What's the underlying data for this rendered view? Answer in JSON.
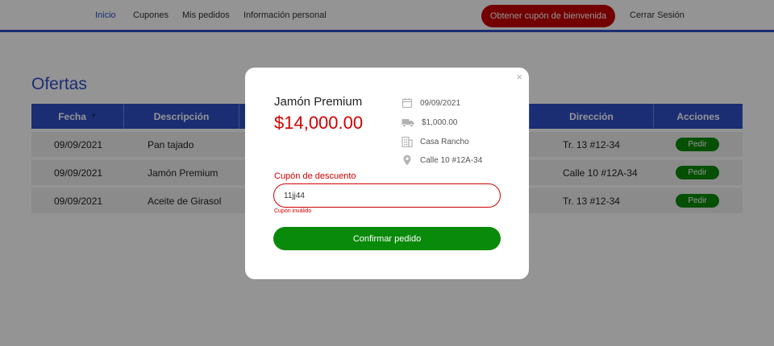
{
  "nav": {
    "items": [
      {
        "label": "Inicio"
      },
      {
        "label": "Cupones"
      },
      {
        "label": "Mis pedidos"
      },
      {
        "label": "Información personal"
      }
    ],
    "coupon_button": "Obtener cupón de bienvenida",
    "logout": "Cerrar Sesión",
    "active_item": "Inicio"
  },
  "page": {
    "title": "Ofertas",
    "table": {
      "headers": {
        "fecha": "Fecha",
        "descripcion": "Descripción",
        "direccion": "Dirección",
        "acciones": "Acciones"
      },
      "rows": [
        {
          "fecha": "09/09/2021",
          "descripcion": "Pan tajado",
          "direccion": "Tr. 13 #12-34",
          "action": "Pedir"
        },
        {
          "fecha": "09/09/2021",
          "descripcion": "Jamón Premium",
          "direccion": "Calle 10 #12A-34",
          "action": "Pedir"
        },
        {
          "fecha": "09/09/2021",
          "descripcion": "Aceite de Girasol",
          "direccion": "Tr. 13 #12-34",
          "action": "Pedir"
        }
      ]
    }
  },
  "modal": {
    "close": "×",
    "product_name": "Jamón Premium",
    "price": "$14,000.00",
    "details": {
      "date": "09/09/2021",
      "shipping": "$1,000.00",
      "store": "Casa Rancho",
      "address": "Calle 10 #12A-34"
    },
    "coupon_label": "Cupón de descuento",
    "coupon_value": "11jj44",
    "coupon_error": "Cupón inválido",
    "confirm_button": "Confirmar pedido"
  },
  "colors": {
    "primary": "#3050c8",
    "danger": "#c40000",
    "success": "#0a8a0a"
  },
  "icons": {
    "sort": "sort-down-icon",
    "date": "calendar-icon",
    "shipping": "truck-icon",
    "store": "building-icon",
    "address": "map-pin-icon",
    "close": "close-icon"
  }
}
